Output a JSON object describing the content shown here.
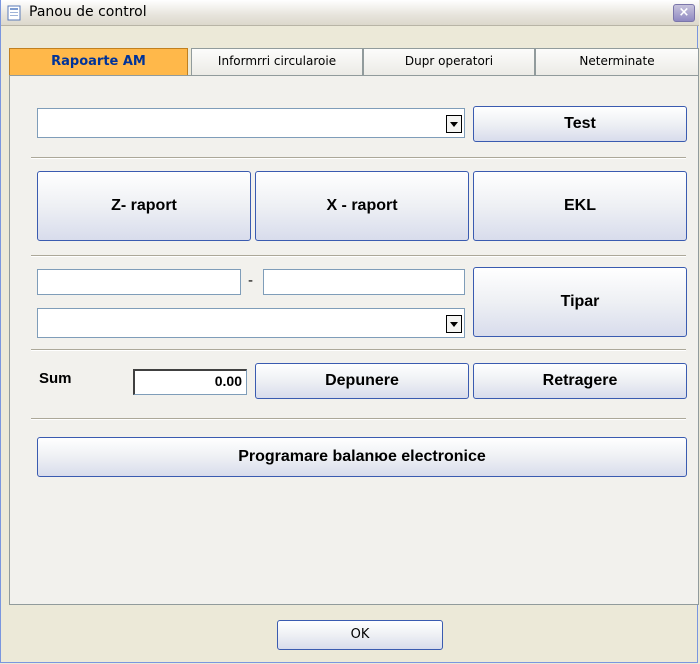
{
  "window": {
    "title": "Panou de control",
    "close_symbol": "×"
  },
  "tabs": [
    {
      "label": "Rapoarte AM",
      "active": true
    },
    {
      "label": "Informrri circularoie",
      "active": false
    },
    {
      "label": "Dupr operatori",
      "active": false
    },
    {
      "label": "Neterminate",
      "active": false
    }
  ],
  "test_row": {
    "combo_value": "",
    "test_label": "Test"
  },
  "report_buttons": {
    "z_label": "Z- raport",
    "x_label": "X - raport",
    "ekl_label": "EKL"
  },
  "range_row": {
    "from_value": "",
    "dash": "-",
    "to_value": "",
    "combo_value": "",
    "print_label": "Tipar"
  },
  "sum_row": {
    "label": "Sum",
    "value": "0.00",
    "deposit_label": "Depunere",
    "withdraw_label": "Retragere"
  },
  "programming": {
    "label": "Programare balanюe electronice"
  },
  "footer": {
    "ok_label": "OK"
  },
  "colors": {
    "active_tab": "#ffb84a",
    "active_tab_text": "#003399",
    "button_border": "#3a5bb0",
    "window_bg": "#ece9d8"
  }
}
